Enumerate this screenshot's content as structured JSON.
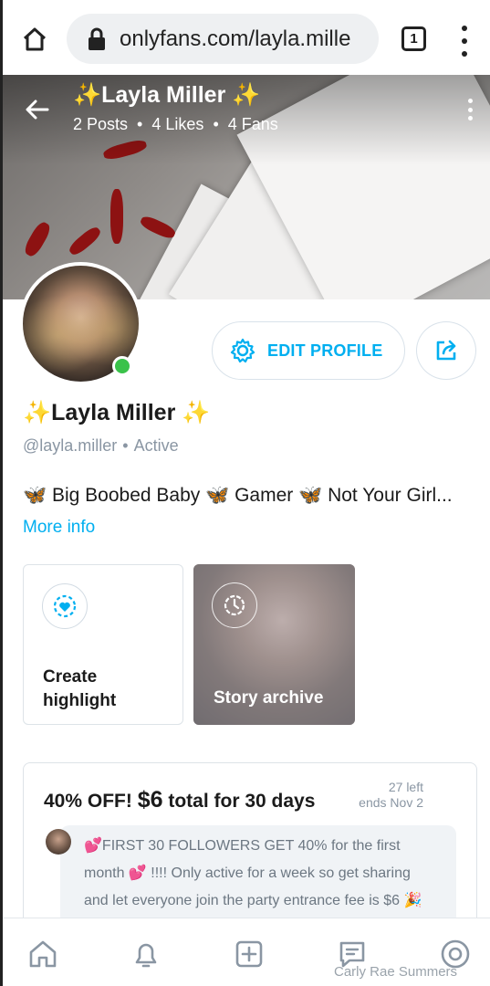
{
  "browser": {
    "url": "onlyfans.com/layla.mille",
    "tab_count": "1"
  },
  "profile": {
    "cover_title": "✨Layla Miller ✨",
    "stats": {
      "posts": "2 Posts",
      "likes": "4 Likes",
      "fans": "4 Fans",
      "separator": "•"
    },
    "name": "✨Layla Miller ✨",
    "handle": "@layla.miller",
    "status": "Active",
    "bio": "🦋 Big Boobed Baby 🦋 Gamer 🦋 Not Your Girl...",
    "more_info": "More info"
  },
  "actions": {
    "edit_profile": "EDIT PROFILE"
  },
  "highlights": {
    "create_line1": "Create",
    "create_line2": "highlight",
    "archive": "Story archive"
  },
  "promo": {
    "title_prefix": "40% OFF!",
    "price": "$6",
    "title_suffix": "total for 30 days",
    "left": "27 left",
    "ends": "ends Nov 2",
    "message_line1": "💕FIRST 30 FOLLOWERS GET 40% for the first",
    "message_line2": "month 💕 !!!! Only active for a week so get sharing",
    "message_line3": "and let everyone join the party entrance fee is $6 🎉"
  },
  "nav": {
    "items": [
      "home-icon",
      "bell-icon",
      "plus-square-icon",
      "chat-icon",
      "profile-icon"
    ]
  },
  "watermark": "Carly Rae Summers",
  "colors": {
    "accent": "#00aff0",
    "online": "#3ac24a",
    "muted": "#8a96a3"
  }
}
